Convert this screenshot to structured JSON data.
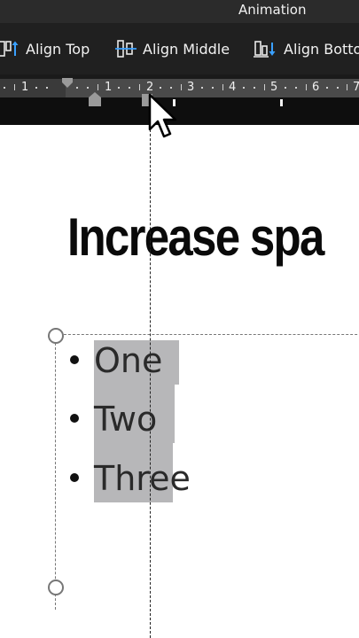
{
  "ribbon": {
    "tab_label": "Animation",
    "align_top": "Align Top",
    "align_middle": "Align Middle",
    "align_bottom": "Align Bottom"
  },
  "ruler": {
    "numbers": [
      "1",
      "1",
      "2",
      "3",
      "4",
      "5",
      "6",
      "7"
    ]
  },
  "slide": {
    "title": "Increase spa",
    "bullets": [
      "One",
      "Two",
      "Three"
    ]
  },
  "colors": {
    "ribbon_bg": "#202020",
    "selection": "#b7b7b9"
  }
}
